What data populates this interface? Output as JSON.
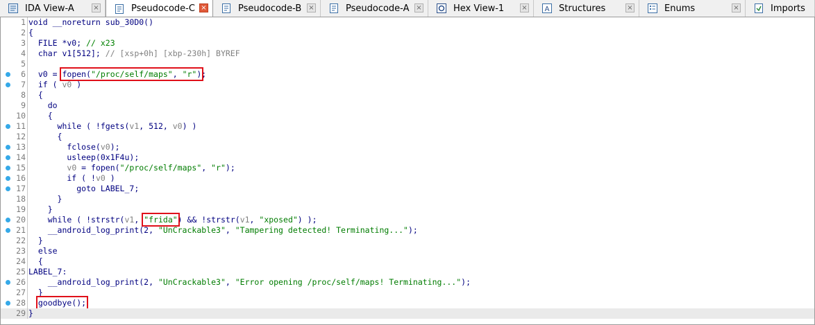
{
  "tabs": [
    {
      "label": "IDA View-A",
      "icon": "ida-view-icon",
      "active": false,
      "close": true
    },
    {
      "label": "Pseudocode-C",
      "icon": "pseudocode-icon",
      "active": true,
      "close": true
    },
    {
      "label": "Pseudocode-B",
      "icon": "pseudocode-icon",
      "active": false,
      "close": true
    },
    {
      "label": "Pseudocode-A",
      "icon": "pseudocode-icon",
      "active": false,
      "close": true
    },
    {
      "label": "Hex View-1",
      "icon": "hex-view-icon",
      "active": false,
      "close": true
    },
    {
      "label": "Structures",
      "icon": "structures-icon",
      "active": false,
      "close": true
    },
    {
      "label": "Enums",
      "icon": "enums-icon",
      "active": false,
      "close": true
    },
    {
      "label": "Imports",
      "icon": "imports-icon",
      "active": false,
      "close": false
    }
  ],
  "code_lines": [
    {
      "n": "1",
      "bp": false,
      "segs": [
        {
          "t": "void __noreturn sub_30D0()"
        }
      ]
    },
    {
      "n": "2",
      "bp": false,
      "segs": [
        {
          "t": "{"
        }
      ]
    },
    {
      "n": "3",
      "bp": false,
      "segs": [
        {
          "t": "  FILE *v0; "
        },
        {
          "t": "// x23",
          "c": "cm"
        }
      ]
    },
    {
      "n": "4",
      "bp": false,
      "segs": [
        {
          "t": "  char v1[512]; "
        },
        {
          "t": "// [xsp+0h] [xbp-230h] BYREF",
          "c": "cmgray"
        }
      ]
    },
    {
      "n": "5",
      "bp": false,
      "segs": [
        {
          "t": ""
        }
      ]
    },
    {
      "n": "6",
      "bp": true,
      "segs": [
        {
          "t": "  v0 = "
        },
        {
          "t": "fopen(",
          "h": true,
          "hg": "a"
        },
        {
          "t": "\"/proc/self/maps\"",
          "c": "str",
          "h": true,
          "hg": "a"
        },
        {
          "t": ", ",
          "h": true,
          "hg": "a"
        },
        {
          "t": "\"r\"",
          "c": "str",
          "h": true,
          "hg": "a"
        },
        {
          "t": ")",
          "h": true,
          "hg": "a"
        },
        {
          "t": ";"
        }
      ]
    },
    {
      "n": "7",
      "bp": true,
      "segs": [
        {
          "t": "  if ( "
        },
        {
          "t": "v0",
          "c": "var"
        },
        {
          "t": " )"
        }
      ]
    },
    {
      "n": "8",
      "bp": false,
      "segs": [
        {
          "t": "  {"
        }
      ]
    },
    {
      "n": "9",
      "bp": false,
      "segs": [
        {
          "t": "    do"
        }
      ]
    },
    {
      "n": "10",
      "bp": false,
      "segs": [
        {
          "t": "    {"
        }
      ]
    },
    {
      "n": "11",
      "bp": true,
      "segs": [
        {
          "t": "      while ( !fgets("
        },
        {
          "t": "v1",
          "c": "var"
        },
        {
          "t": ", 512, "
        },
        {
          "t": "v0",
          "c": "var"
        },
        {
          "t": ") )"
        }
      ]
    },
    {
      "n": "12",
      "bp": false,
      "segs": [
        {
          "t": "      {"
        }
      ]
    },
    {
      "n": "13",
      "bp": true,
      "segs": [
        {
          "t": "        fclose("
        },
        {
          "t": "v0",
          "c": "var"
        },
        {
          "t": ");"
        }
      ]
    },
    {
      "n": "14",
      "bp": true,
      "segs": [
        {
          "t": "        usleep(0x1F4u);"
        }
      ]
    },
    {
      "n": "15",
      "bp": true,
      "segs": [
        {
          "t": "        "
        },
        {
          "t": "v0",
          "c": "var"
        },
        {
          "t": " = fopen("
        },
        {
          "t": "\"/proc/self/maps\"",
          "c": "str"
        },
        {
          "t": ", "
        },
        {
          "t": "\"r\"",
          "c": "str"
        },
        {
          "t": ");"
        }
      ]
    },
    {
      "n": "16",
      "bp": true,
      "segs": [
        {
          "t": "        if ( !"
        },
        {
          "t": "v0",
          "c": "var"
        },
        {
          "t": " )"
        }
      ]
    },
    {
      "n": "17",
      "bp": true,
      "segs": [
        {
          "t": "          goto LABEL_7;"
        }
      ]
    },
    {
      "n": "18",
      "bp": false,
      "segs": [
        {
          "t": "      }"
        }
      ]
    },
    {
      "n": "19",
      "bp": false,
      "segs": [
        {
          "t": "    }"
        }
      ]
    },
    {
      "n": "20",
      "bp": true,
      "segs": [
        {
          "t": "    while ( !strstr("
        },
        {
          "t": "v1",
          "c": "var"
        },
        {
          "t": ", "
        },
        {
          "t": "\"frida\"",
          "c": "str",
          "h": true,
          "hg": "b"
        },
        {
          "t": ") && !strstr("
        },
        {
          "t": "v1",
          "c": "var"
        },
        {
          "t": ", "
        },
        {
          "t": "\"xposed\"",
          "c": "str"
        },
        {
          "t": ") );"
        }
      ]
    },
    {
      "n": "21",
      "bp": true,
      "segs": [
        {
          "t": "    __android_log_print(2, "
        },
        {
          "t": "\"UnCrackable3\"",
          "c": "str"
        },
        {
          "t": ", "
        },
        {
          "t": "\"Tampering detected! Terminating...\"",
          "c": "str"
        },
        {
          "t": ");"
        }
      ]
    },
    {
      "n": "22",
      "bp": false,
      "segs": [
        {
          "t": "  }"
        }
      ]
    },
    {
      "n": "23",
      "bp": false,
      "segs": [
        {
          "t": "  else"
        }
      ]
    },
    {
      "n": "24",
      "bp": false,
      "segs": [
        {
          "t": "  {"
        }
      ]
    },
    {
      "n": "25",
      "bp": false,
      "segs": [
        {
          "t": "LABEL_7:"
        }
      ]
    },
    {
      "n": "26",
      "bp": true,
      "segs": [
        {
          "t": "    __android_log_print(2, "
        },
        {
          "t": "\"UnCrackable3\"",
          "c": "str"
        },
        {
          "t": ", "
        },
        {
          "t": "\"Error opening /proc/self/maps! Terminating...\"",
          "c": "str"
        },
        {
          "t": ");"
        }
      ]
    },
    {
      "n": "27",
      "bp": false,
      "segs": [
        {
          "t": "  }"
        }
      ]
    },
    {
      "n": "28",
      "bp": true,
      "segs": [
        {
          "t": "  "
        },
        {
          "t": "goodbye();",
          "h": true,
          "hg": "c"
        }
      ]
    },
    {
      "n": "29",
      "bp": false,
      "current": true,
      "segs": [
        {
          "t": "}"
        }
      ]
    }
  ],
  "colors": {
    "highlight_box": "#e0101a",
    "breakpoint_dot": "#35a9e8",
    "code_text": "#000080",
    "string": "#007c00",
    "comment": "#008000",
    "variable": "#808080"
  }
}
